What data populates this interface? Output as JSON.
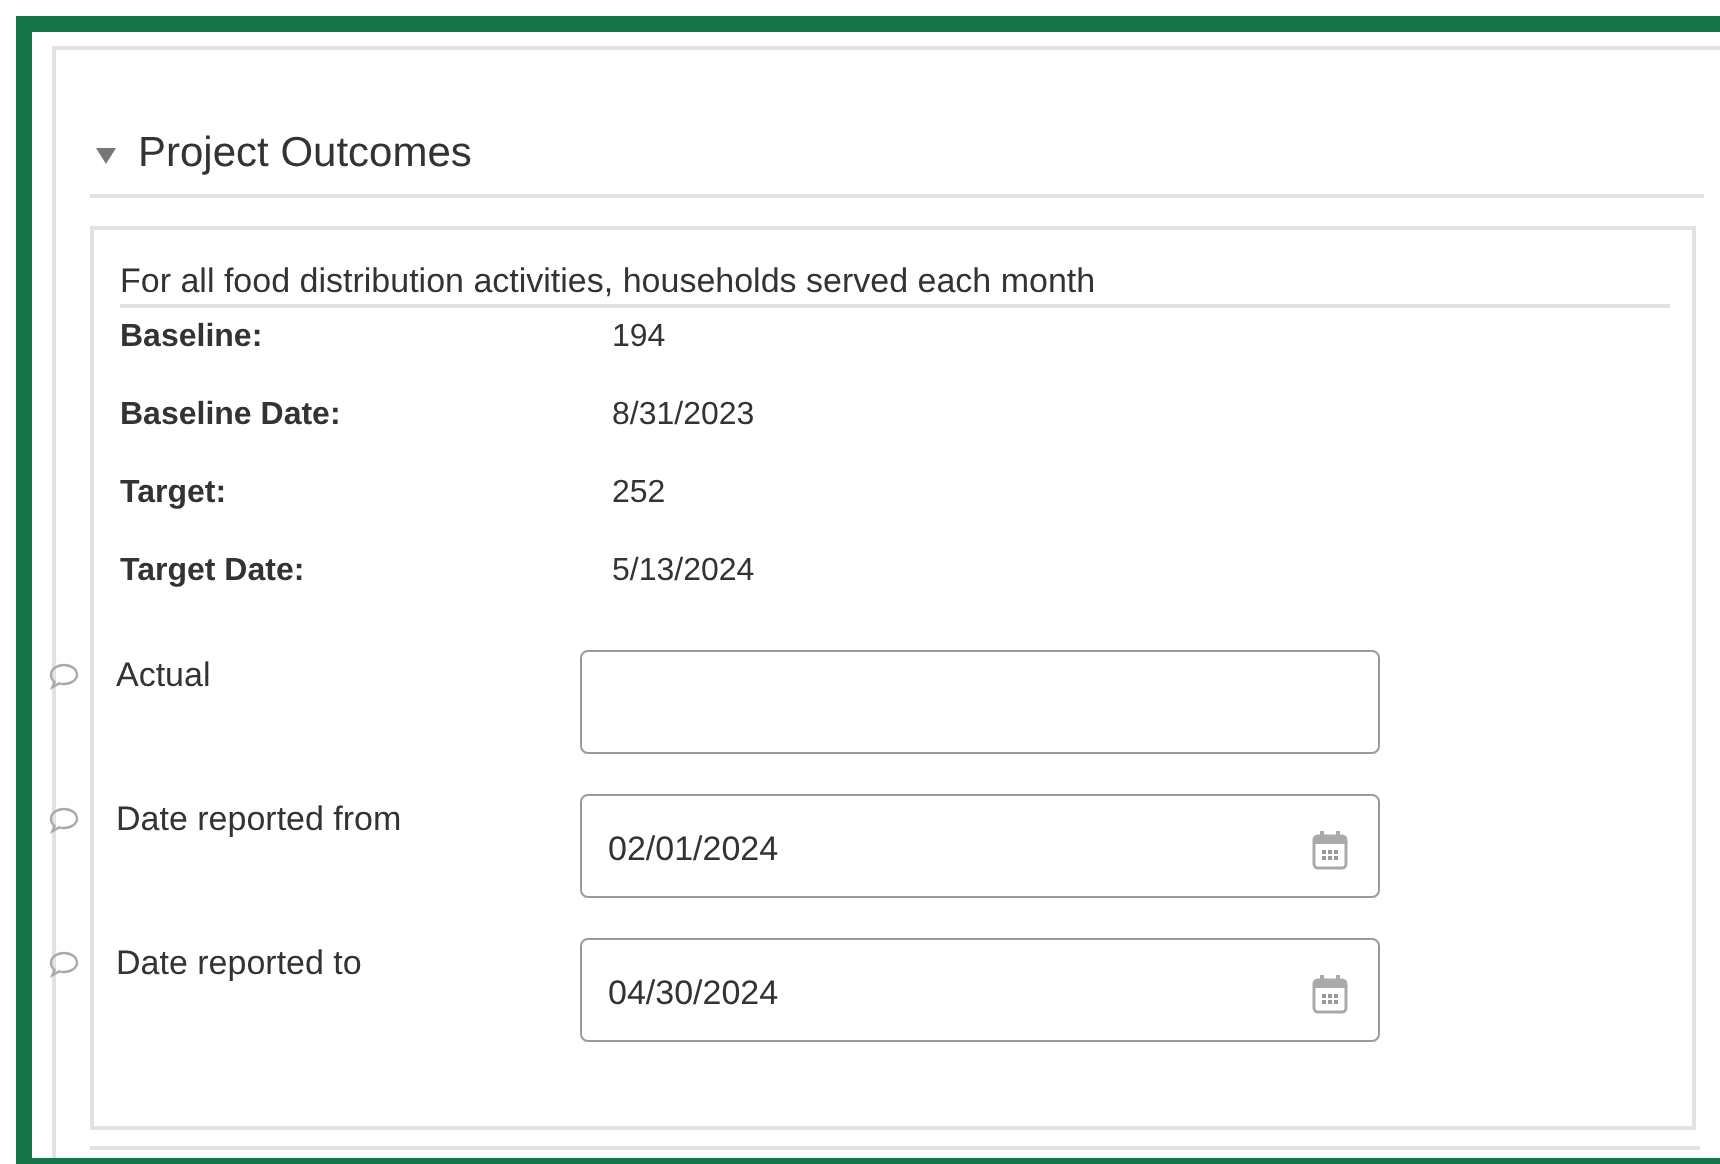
{
  "section": {
    "title": "Project Outcomes",
    "expanded": true
  },
  "indicator": "For all food distribution activities, households served each month",
  "details": [
    {
      "label": "Baseline:",
      "value": "194"
    },
    {
      "label": "Baseline Date:",
      "value": "8/31/2023"
    },
    {
      "label": "Target:",
      "value": "252"
    },
    {
      "label": "Target Date:",
      "value": "5/13/2024"
    }
  ],
  "fields": [
    {
      "label": "Actual",
      "kind": "text"
    },
    {
      "label": "Date reported from",
      "kind": "date",
      "value": "02/01/2024"
    },
    {
      "label": "Date reported to",
      "kind": "date",
      "value": "04/30/2024"
    }
  ]
}
